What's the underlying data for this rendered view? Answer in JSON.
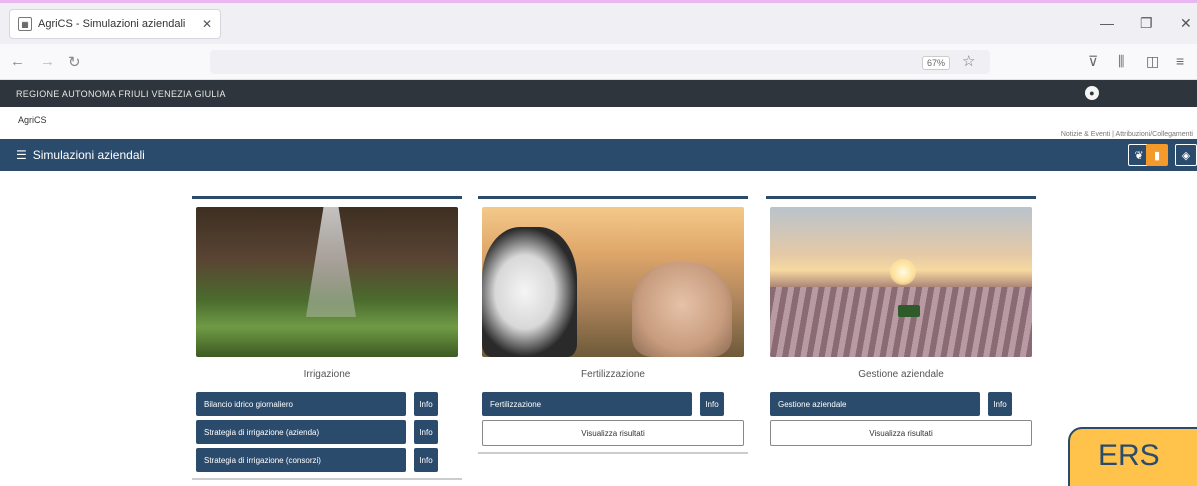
{
  "browser": {
    "tab_title": "AgriCS - Simulazioni aziendali",
    "zoom": "67%"
  },
  "site": {
    "region": "REGIONE AUTONOMA FRIULI VENEZIA GIULIA",
    "logo": "AgriCS",
    "top_links": "Notizie & Eventi | Attribuzioni/Collegamenti",
    "page_title": "Simulazioni aziendali"
  },
  "cards": [
    {
      "title": "Irrigazione",
      "buttons": [
        {
          "label": "Bilancio idrico giornaliero",
          "info": "Info"
        },
        {
          "label": "Strategia di irrigazione (azienda)",
          "info": "Info"
        },
        {
          "label": "Strategia di irrigazione (consorzi)",
          "info": "Info"
        }
      ]
    },
    {
      "title": "Fertilizzazione",
      "buttons": [
        {
          "label": "Fertilizzazione",
          "info": "Info"
        }
      ],
      "view_label": "Visualizza risultati"
    },
    {
      "title": "Gestione aziendale",
      "buttons": [
        {
          "label": "Gestione aziendale",
          "info": "Info"
        }
      ],
      "view_label": "Visualizza risultati"
    }
  ],
  "badge": "ERS",
  "colors": {
    "primary": "#2b4b6c",
    "header_dark": "#2f353c",
    "accent_orange": "#f39a2b",
    "badge_yellow": "#ffc24a"
  }
}
